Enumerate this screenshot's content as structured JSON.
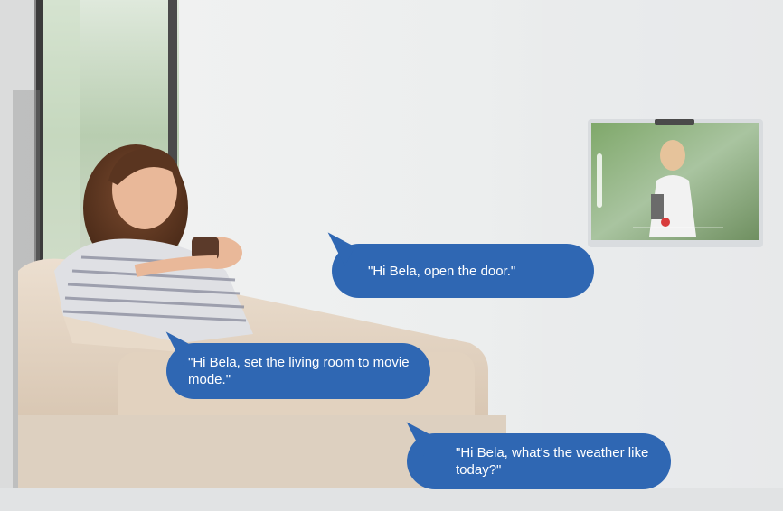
{
  "bubbles": {
    "door": "\"Hi Bela, open the door.\"",
    "living_room": "\"Hi Bela, set the living room to movie mode.\"",
    "weather": "\"Hi Bela, what's the weather like today?\""
  },
  "colors": {
    "bubble": "#2f67b3",
    "wall": "#eef0f1",
    "sofa": "#e6d6c4"
  },
  "icons": [
    "tablet-video-intercom-icon",
    "end-call-icon"
  ]
}
